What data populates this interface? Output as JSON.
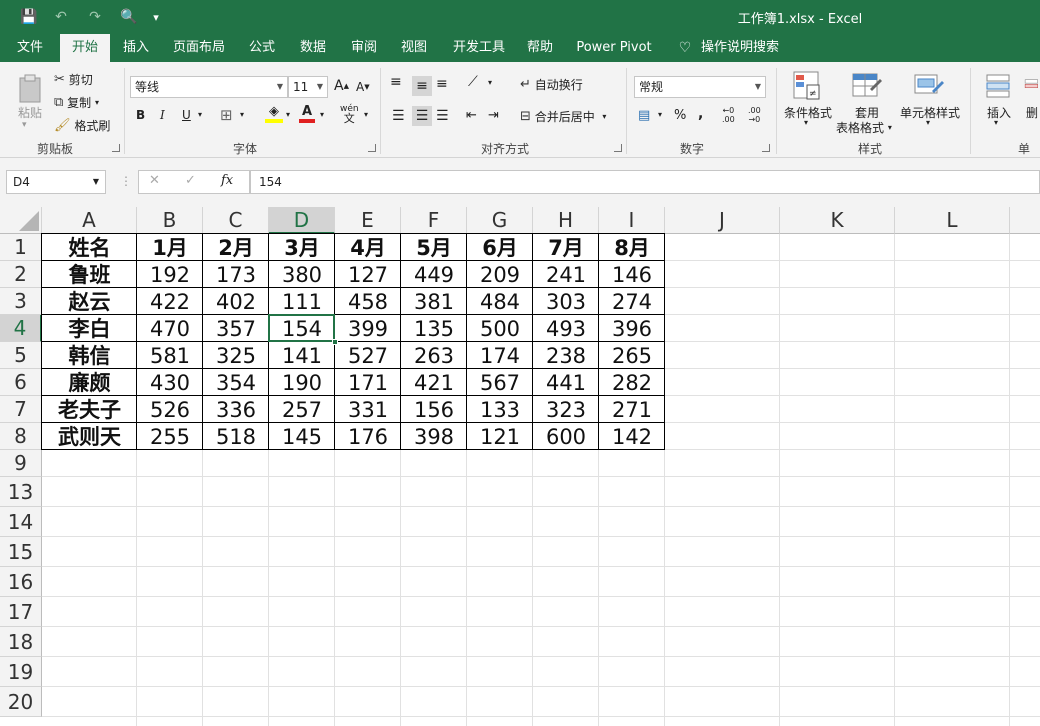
{
  "window": {
    "title": "工作簿1.xlsx  -  Excel"
  },
  "quick_access": {
    "save_icon": "💾",
    "undo_icon": "↶",
    "redo_icon": "↷",
    "preview_icon": "🔍",
    "more_icon": "▾"
  },
  "tabs": [
    "文件",
    "开始",
    "插入",
    "页面布局",
    "公式",
    "数据",
    "审阅",
    "视图",
    "开发工具",
    "帮助",
    "Power Pivot",
    "操作说明搜索"
  ],
  "active_tab": "开始",
  "ribbon": {
    "clipboard": {
      "paste": "粘贴",
      "cut": "剪切",
      "copy": "复制",
      "format_painter": "格式刷",
      "label": "剪贴板"
    },
    "font": {
      "name": "等线",
      "size": "11",
      "bold": "B",
      "italic": "I",
      "underline": "U",
      "grow": "A",
      "shrink": "A",
      "phonetic": "wén",
      "label": "字体"
    },
    "alignment": {
      "wrap": "自动换行",
      "merge": "合并后居中",
      "label": "对齐方式"
    },
    "number": {
      "format": "常规",
      "percent": "%",
      "comma": ",",
      "label": "数字"
    },
    "styles": {
      "conditional": "条件格式",
      "table1": "套用",
      "table2": "表格格式",
      "cell": "单元格样式",
      "label": "样式"
    },
    "cells": {
      "insert": "插入",
      "delete": "删",
      "label": "单"
    }
  },
  "formula_bar": {
    "name_box": "D4",
    "fx": "fx",
    "cancel": "✕",
    "enter": "✓",
    "value": "154"
  },
  "columns": [
    "A",
    "B",
    "C",
    "D",
    "E",
    "F",
    "G",
    "H",
    "I",
    "J",
    "K",
    "L"
  ],
  "selected_column": "D",
  "rows": [
    "1",
    "2",
    "3",
    "4",
    "5",
    "6",
    "7",
    "8",
    "9",
    "13",
    "14",
    "15",
    "16",
    "17",
    "18",
    "19",
    "20"
  ],
  "selected_row": "4",
  "table": {
    "header": [
      "姓名",
      "1月",
      "2月",
      "3月",
      "4月",
      "5月",
      "6月",
      "7月",
      "8月"
    ],
    "body": [
      [
        "鲁班",
        "192",
        "173",
        "380",
        "127",
        "449",
        "209",
        "241",
        "146"
      ],
      [
        "赵云",
        "422",
        "402",
        "111",
        "458",
        "381",
        "484",
        "303",
        "274"
      ],
      [
        "李白",
        "470",
        "357",
        "154",
        "399",
        "135",
        "500",
        "493",
        "396"
      ],
      [
        "韩信",
        "581",
        "325",
        "141",
        "527",
        "263",
        "174",
        "238",
        "265"
      ],
      [
        "廉颇",
        "430",
        "354",
        "190",
        "171",
        "421",
        "567",
        "441",
        "282"
      ],
      [
        "老夫子",
        "526",
        "336",
        "257",
        "331",
        "156",
        "133",
        "323",
        "271"
      ],
      [
        "武则天",
        "255",
        "518",
        "145",
        "176",
        "398",
        "121",
        "600",
        "142"
      ]
    ]
  },
  "colors": {
    "accent": "#217346",
    "ribbon_bg": "#f3f3f3",
    "header_sel": "#d3d3d3"
  }
}
